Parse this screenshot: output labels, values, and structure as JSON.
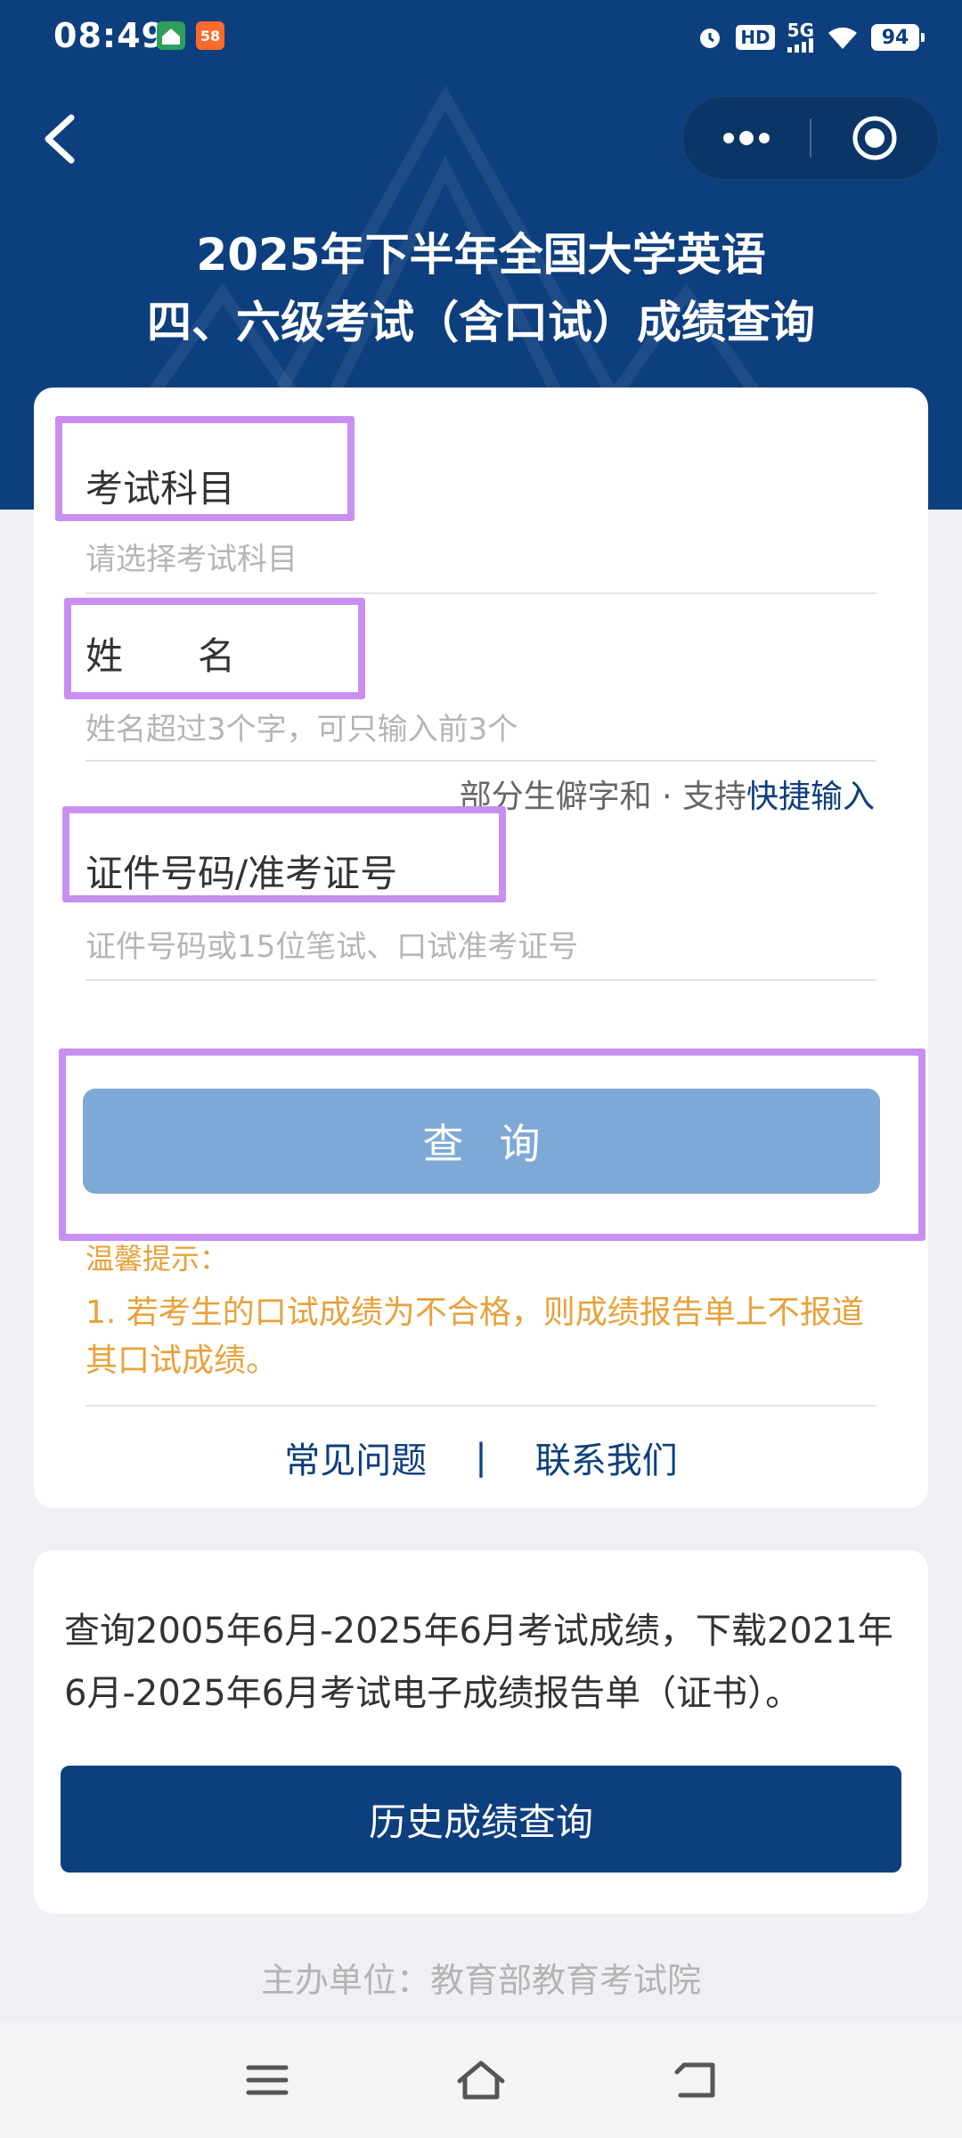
{
  "status_bar": {
    "time": "08:49",
    "app_badge": "58",
    "hd": "HD",
    "network": "5G",
    "battery": "94"
  },
  "header": {
    "title_line1": "2025年下半年全国大学英语",
    "title_line2": "四、六级考试（含口试）成绩查询"
  },
  "form": {
    "subject_label": "考试科目",
    "subject_placeholder": "请选择考试科目",
    "name_label": "姓　　名",
    "name_placeholder": "姓名超过3个字，可只输入前3个",
    "rare_char_hint": "部分生僻字和 · 支持",
    "rare_char_link": "快捷输入",
    "id_label": "证件号码/准考证号",
    "id_placeholder": "证件号码或15位笔试、口试准考证号",
    "query_button": "查询"
  },
  "tips": {
    "title": "温馨提示：",
    "item1": "1. 若考生的口试成绩为不合格，则成绩报告单上不报道其口试成绩。"
  },
  "links": {
    "faq": "常见问题",
    "separator": "|",
    "contact": "联系我们"
  },
  "history": {
    "description": "查询2005年6月-2025年6月考试成绩，下载2021年6月-2025年6月考试电子成绩报告单（证书）。",
    "button": "历史成绩查询"
  },
  "footer": {
    "organizer": "主办单位：教育部教育考试院"
  },
  "colors": {
    "header_bg": "#0d3f7e",
    "query_button_bg": "#7ea9d6",
    "history_button_bg": "#0d3f7e",
    "tip_text": "#e8a13a",
    "highlight_box": "#c98ff0"
  }
}
